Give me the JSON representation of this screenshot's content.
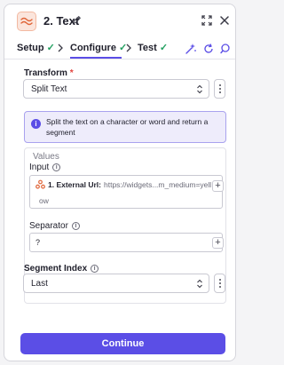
{
  "header": {
    "title": "2. Text",
    "icons": [
      "text-approx-icon",
      "pencil-icon",
      "expand-icon",
      "close-icon"
    ]
  },
  "tabs": [
    {
      "label": "Setup",
      "status": "✓"
    },
    {
      "label": "Configure",
      "status": "✓",
      "active": true
    },
    {
      "label": "Test",
      "status": "✓"
    }
  ],
  "tools": [
    "magic-wand-icon",
    "refresh-icon",
    "search-icon"
  ],
  "transform": {
    "label": "Transform",
    "required_mark": "*",
    "value": "Split Text"
  },
  "note": {
    "text": "Split the text on a character or word and return a segment"
  },
  "values": {
    "title": "Values",
    "input": {
      "label": "Input",
      "token_label": "1. External Url:",
      "token_value": "https://widgets...m_medium=yell",
      "token_value_wrap": "ow"
    },
    "separator": {
      "label": "Separator",
      "value": "?"
    }
  },
  "segment_index": {
    "label": "Segment Index",
    "value": "Last"
  },
  "footer": {
    "continue_label": "Continue"
  },
  "colors": {
    "accent": "#5b4ee6",
    "success": "#22a060",
    "required": "#e2423c",
    "app_icon_bg": "#fbe5dc"
  }
}
